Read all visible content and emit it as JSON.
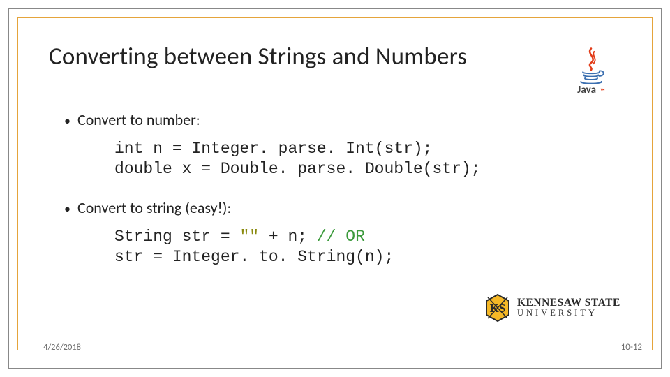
{
  "title": "Converting between Strings and Numbers",
  "java_logo_text": "Java",
  "bullets": [
    "Convert to number:",
    "Convert to string (easy!):"
  ],
  "code1_line1": "int n = Integer. parse. Int(str);",
  "code1_line2": "double x = Double. parse. Double(str);",
  "code2_line1_a": "String str = ",
  "code2_line1_str": "\"\"",
  "code2_line1_b": " + n; ",
  "code2_line1_comment": "// OR",
  "code2_line2": "str = Integer. to. String(n);",
  "footer": {
    "date": "4/26/2018",
    "page": "10-12"
  },
  "ksu": {
    "line1": "KENNESAW STATE",
    "line2": "UNIVERSITY"
  }
}
